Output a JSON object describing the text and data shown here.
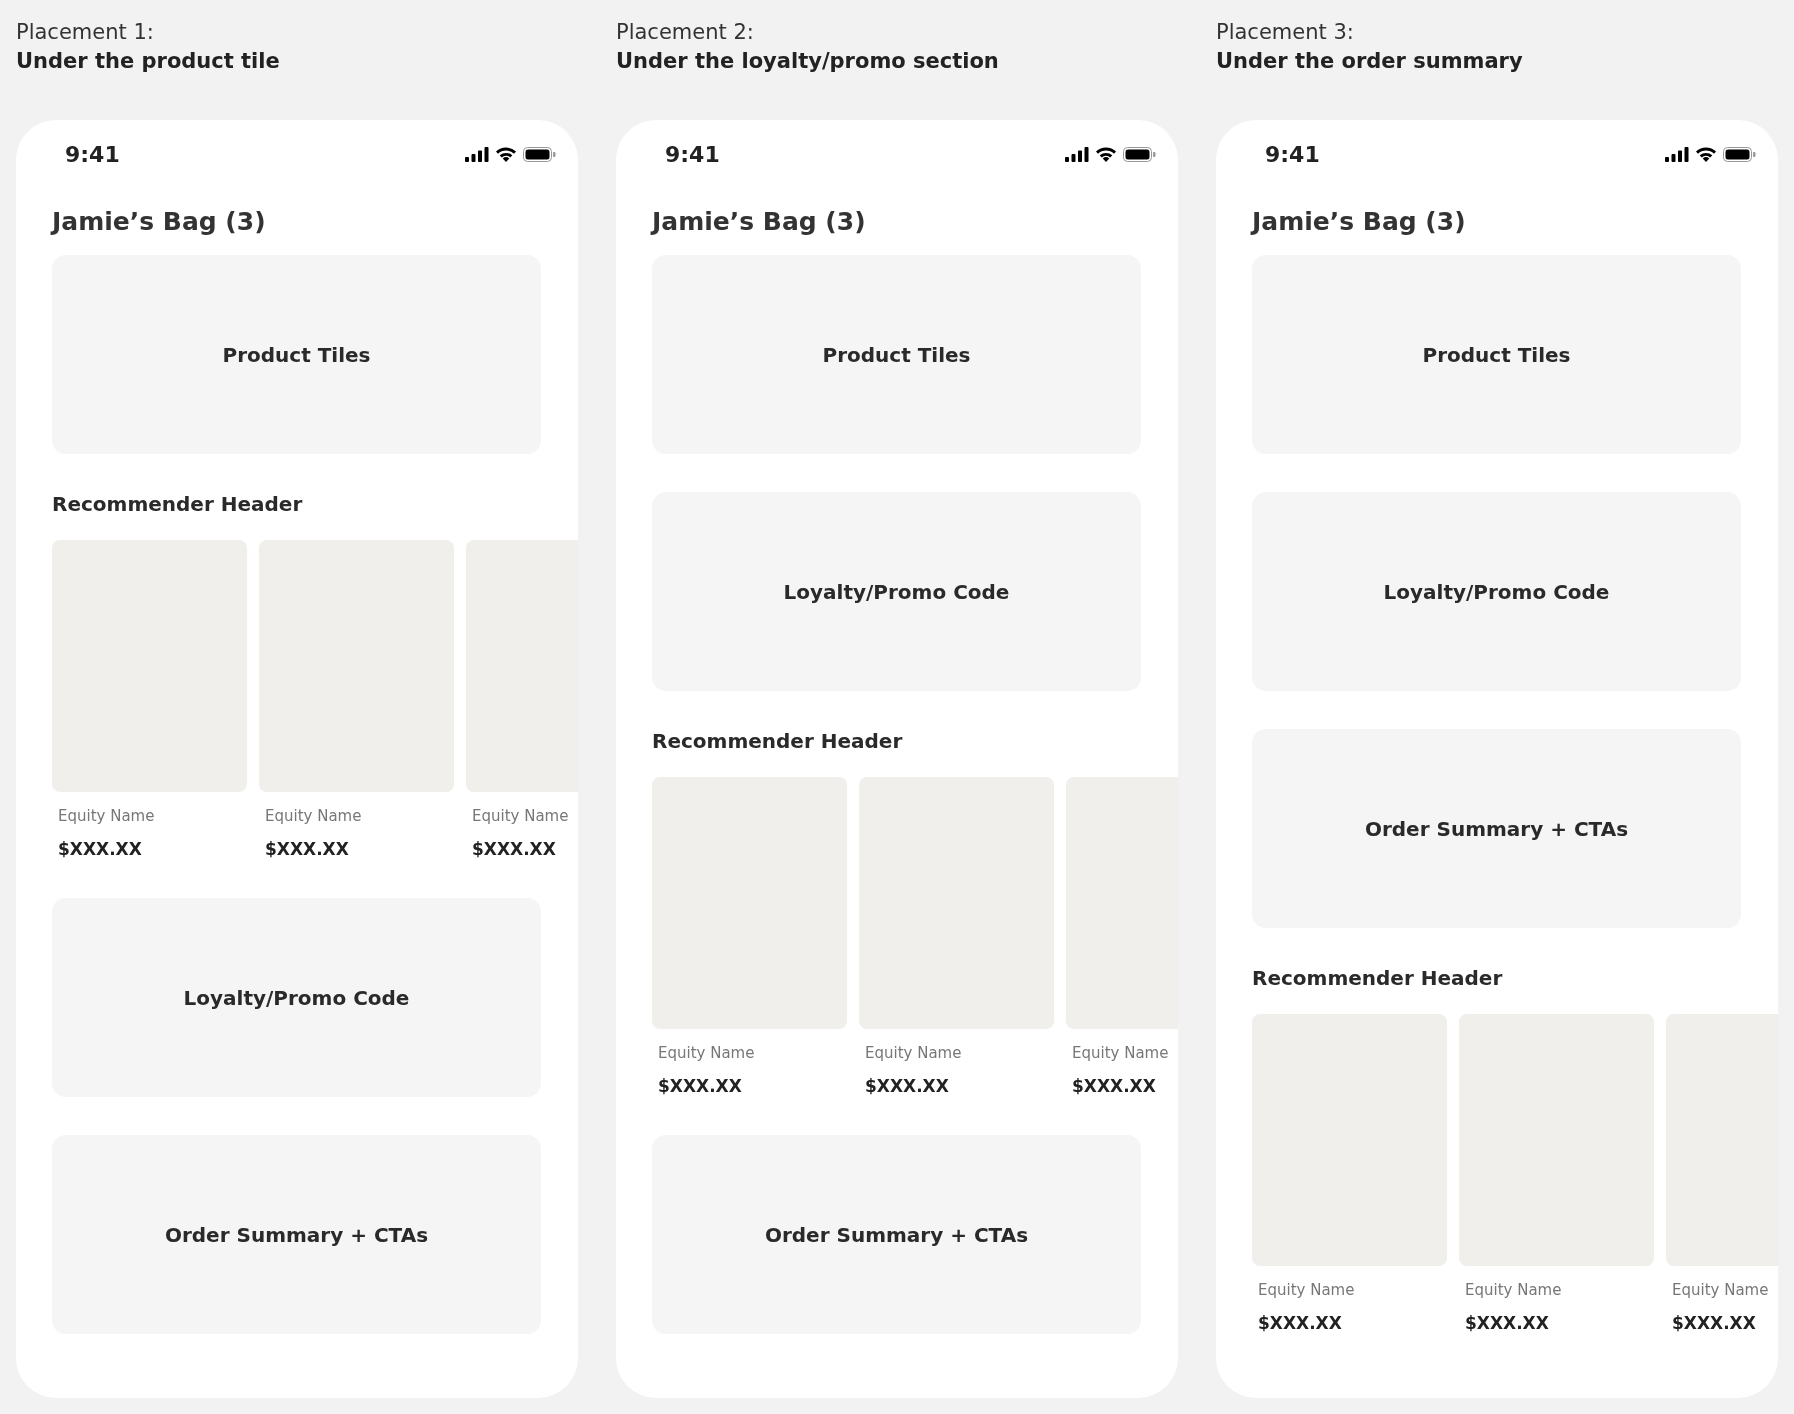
{
  "placements": [
    {
      "label": "Placement 1:",
      "caption": "Under the product tile",
      "phone": {
        "time": "9:41",
        "bag_title": "Jamie’s Bag (3)",
        "sections": [
          {
            "kind": "block",
            "label": "Product Tiles"
          },
          {
            "kind": "recommender",
            "header": "Recommender Header",
            "items": [
              {
                "name": "Equity Name",
                "price": "$XXX.XX"
              },
              {
                "name": "Equity Name",
                "price": "$XXX.XX"
              },
              {
                "name": "Equity Name",
                "price": "$XXX.XX"
              }
            ]
          },
          {
            "kind": "block",
            "label": "Loyalty/Promo Code"
          },
          {
            "kind": "block",
            "label": "Order Summary + CTAs"
          }
        ]
      }
    },
    {
      "label": "Placement 2:",
      "caption": "Under the loyalty/promo section",
      "phone": {
        "time": "9:41",
        "bag_title": "Jamie’s Bag (3)",
        "sections": [
          {
            "kind": "block",
            "label": "Product Tiles"
          },
          {
            "kind": "block",
            "label": "Loyalty/Promo Code"
          },
          {
            "kind": "recommender",
            "header": "Recommender Header",
            "items": [
              {
                "name": "Equity Name",
                "price": "$XXX.XX"
              },
              {
                "name": "Equity Name",
                "price": "$XXX.XX"
              },
              {
                "name": "Equity Name",
                "price": "$XXX.XX"
              }
            ]
          },
          {
            "kind": "block",
            "label": "Order Summary + CTAs"
          }
        ]
      }
    },
    {
      "label": "Placement 3:",
      "caption": "Under the order summary",
      "phone": {
        "time": "9:41",
        "bag_title": "Jamie’s Bag (3)",
        "sections": [
          {
            "kind": "block",
            "label": "Product Tiles"
          },
          {
            "kind": "block",
            "label": "Loyalty/Promo Code"
          },
          {
            "kind": "block",
            "label": "Order Summary + CTAs"
          },
          {
            "kind": "recommender",
            "header": "Recommender Header",
            "items": [
              {
                "name": "Equity Name",
                "price": "$XXX.XX"
              },
              {
                "name": "Equity Name",
                "price": "$XXX.XX"
              },
              {
                "name": "Equity Name",
                "price": "$XXX.XX"
              }
            ]
          }
        ]
      }
    }
  ]
}
